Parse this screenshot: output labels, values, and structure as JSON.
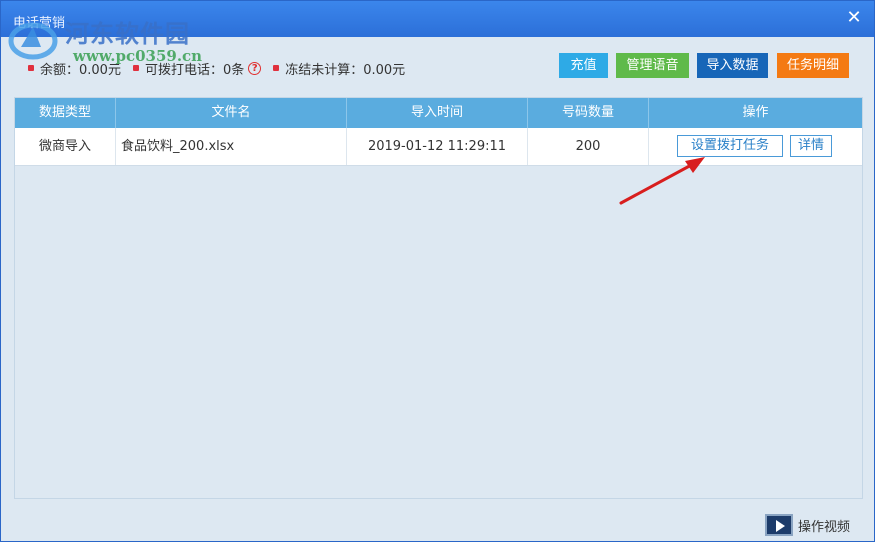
{
  "window": {
    "title": "电话营销"
  },
  "watermark": {
    "text": "河东软件园",
    "url": "www.pc0359.cn"
  },
  "stats": {
    "balance": "余额：0.00元",
    "callable": "可拨打电话：0条",
    "frozen": "冻结未计算：0.00元"
  },
  "toolbar": {
    "recharge": "充值",
    "manage_voice": "管理语音",
    "import_data": "导入数据",
    "task_detail": "任务明细"
  },
  "table": {
    "headers": [
      "数据类型",
      "文件名",
      "导入时间",
      "号码数量",
      "操作"
    ],
    "rows": [
      {
        "type": "微商导入",
        "filename": "食品饮料_200.xlsx",
        "import_time": "2019-01-12 11:29:11",
        "count": "200",
        "action_set": "设置拨打任务",
        "action_detail": "详情"
      }
    ]
  },
  "footer": {
    "video": "操作视频"
  },
  "colors": {
    "titlebar": "#2c6fd8",
    "header": "#5aacdf",
    "recharge": "#2eaae6",
    "voice": "#5fba4a",
    "import": "#1766b8",
    "task": "#f47a13",
    "dot": "#e0313e"
  }
}
